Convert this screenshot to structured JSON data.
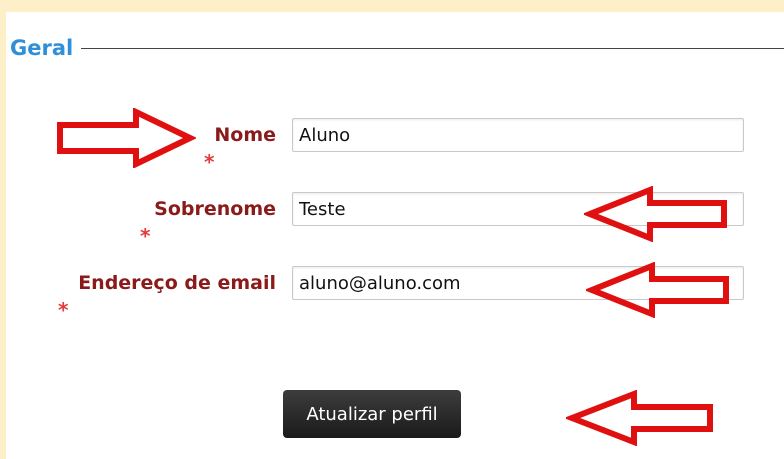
{
  "section": {
    "title": "Geral"
  },
  "fields": {
    "nome": {
      "label": "Nome",
      "value": "Aluno",
      "required_mark": "*"
    },
    "sobrenome": {
      "label": "Sobrenome",
      "value": "Teste",
      "required_mark": "*"
    },
    "email": {
      "label": "Endereço de email",
      "value": "aluno@aluno.com",
      "required_mark": "*"
    }
  },
  "submit_label": "Atualizar perfil",
  "colors": {
    "background": "#fdf0c8",
    "section_title": "#2f8fd8",
    "label": "#8b1a1a",
    "required": "#e23b3b",
    "annotation_arrow": "#e01010",
    "button": "#222222"
  },
  "annotation_arrows": [
    "right-arrow-icon",
    "left-arrow-icon",
    "left-arrow-icon",
    "left-arrow-icon"
  ]
}
